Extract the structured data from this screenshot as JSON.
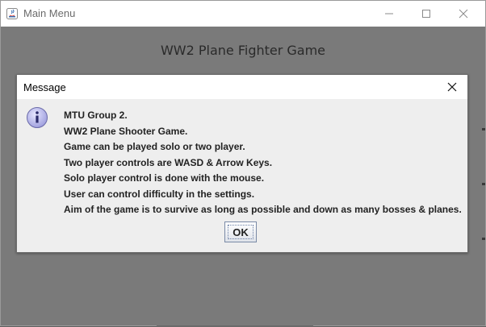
{
  "main_window": {
    "title": "Main Menu",
    "game_title": "WW2 Plane Fighter Game",
    "controls": {
      "minimize_icon": "minimize-icon",
      "maximize_icon": "maximize-icon",
      "close_icon": "close-icon"
    }
  },
  "dialog": {
    "title": "Message",
    "icon": "info-icon",
    "message_lines": [
      "MTU Group 2.",
      "WW2 Plane Shooter Game.",
      "Game can be played solo or two player.",
      "Two player controls are WASD & Arrow Keys.",
      "Solo player control is done with the mouse.",
      "User can control difficulty in the settings.",
      "Aim of the game is to survive as long as possible and down as many bosses & planes."
    ],
    "ok_label": "OK"
  },
  "colors": {
    "background_dim": "#7a7a7a",
    "dialog_bg": "#eeeeee",
    "info_icon_fill": "#b9b9ee",
    "button_border": "#7a8aa6"
  }
}
